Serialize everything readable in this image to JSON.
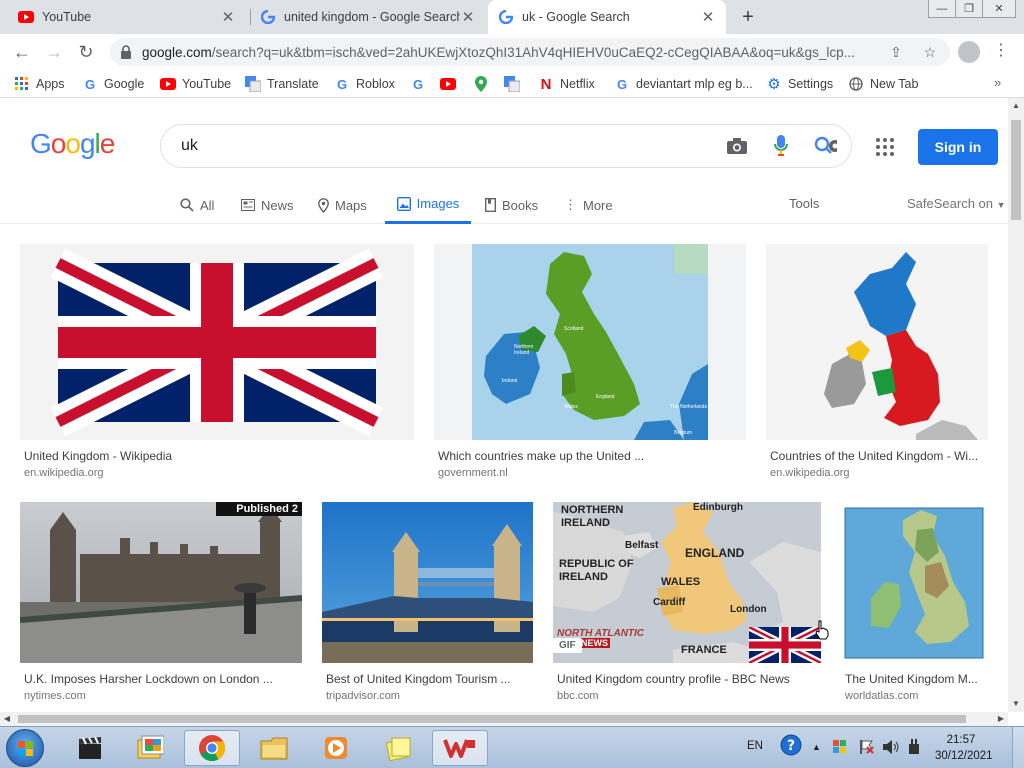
{
  "browser": {
    "tabs": [
      {
        "title": "YouTube",
        "favicon": "youtube-icon",
        "active": false
      },
      {
        "title": "united kingdom - Google Search",
        "favicon": "google-icon",
        "active": false
      },
      {
        "title": "uk - Google Search",
        "favicon": "google-icon",
        "active": true
      }
    ],
    "new_tab_label": "+",
    "url_main": "google.com",
    "url_rest": "/search?q=uk&tbm=isch&ved=2ahUKEwjXtozQhI31AhV4qHIEHV0uCaEQ2-cCegQIABAA&oq=uk&gs_lcp...",
    "bookmarks": [
      {
        "label": "Apps",
        "icon": "apps-grid-icon"
      },
      {
        "label": "Google",
        "icon": "google-icon"
      },
      {
        "label": "YouTube",
        "icon": "youtube-icon"
      },
      {
        "label": "Translate",
        "icon": "translate-icon"
      },
      {
        "label": "Roblox",
        "icon": "roblox-icon"
      },
      {
        "label": "",
        "icon": "google-icon"
      },
      {
        "label": "",
        "icon": "youtube-icon"
      },
      {
        "label": "",
        "icon": "maps-pin-icon"
      },
      {
        "label": "",
        "icon": "translate-icon"
      },
      {
        "label": "Netflix",
        "icon": "netflix-icon"
      },
      {
        "label": "deviantart mlp eg b...",
        "icon": "google-icon"
      },
      {
        "label": "Settings",
        "icon": "gear-icon"
      },
      {
        "label": "New Tab",
        "icon": "globe-icon"
      }
    ],
    "bookmarks_overflow": "»"
  },
  "google": {
    "logo": [
      "G",
      "o",
      "o",
      "g",
      "l",
      "e"
    ],
    "query": "uk",
    "sign_in": "Sign in",
    "tabs": [
      {
        "label": "All",
        "icon": "search-icon",
        "active": false
      },
      {
        "label": "News",
        "icon": "news-icon",
        "active": false
      },
      {
        "label": "Maps",
        "icon": "maps-pin-icon",
        "active": false
      },
      {
        "label": "Images",
        "icon": "images-icon",
        "active": true
      },
      {
        "label": "Books",
        "icon": "books-icon",
        "active": false
      },
      {
        "label": "More",
        "icon": "more-vert-icon",
        "active": false
      }
    ],
    "tools": "Tools",
    "safesearch": "SafeSearch on"
  },
  "results": [
    {
      "title": "United Kingdom - Wikipedia",
      "site": "en.wikipedia.org"
    },
    {
      "title": "Which countries make up the United ...",
      "site": "government.nl"
    },
    {
      "title": "Countries of the United Kingdom - Wi...",
      "site": "en.wikipedia.org"
    },
    {
      "title": "U.K. Imposes Harsher Lockdown on London ...",
      "site": "nytimes.com",
      "badge": "Published 2"
    },
    {
      "title": "Best of United Kingdom Tourism ...",
      "site": "tripadvisor.com"
    },
    {
      "title": "United Kingdom country profile - BBC News",
      "site": "bbc.com",
      "badge": "GIF",
      "map_labels": [
        "NORTHERN IRELAND",
        "Edinburgh",
        "Belfast",
        "ENGLAND",
        "REPUBLIC OF IRELAND",
        "WALES",
        "Cardiff",
        "London",
        "NORTH ATLANTIC",
        "NEWS",
        "FRANCE"
      ]
    },
    {
      "title": "The United Kingdom M...",
      "site": "worldatlas.com"
    }
  ],
  "map_small_labels": {
    "nl_map": [
      "Scotland",
      "Northern Ireland",
      "Ireland",
      "Wales",
      "England",
      "The Netherlands",
      "Belgium"
    ]
  },
  "taskbar": {
    "language": "EN",
    "time": "21:57",
    "date": "30/12/2021"
  }
}
